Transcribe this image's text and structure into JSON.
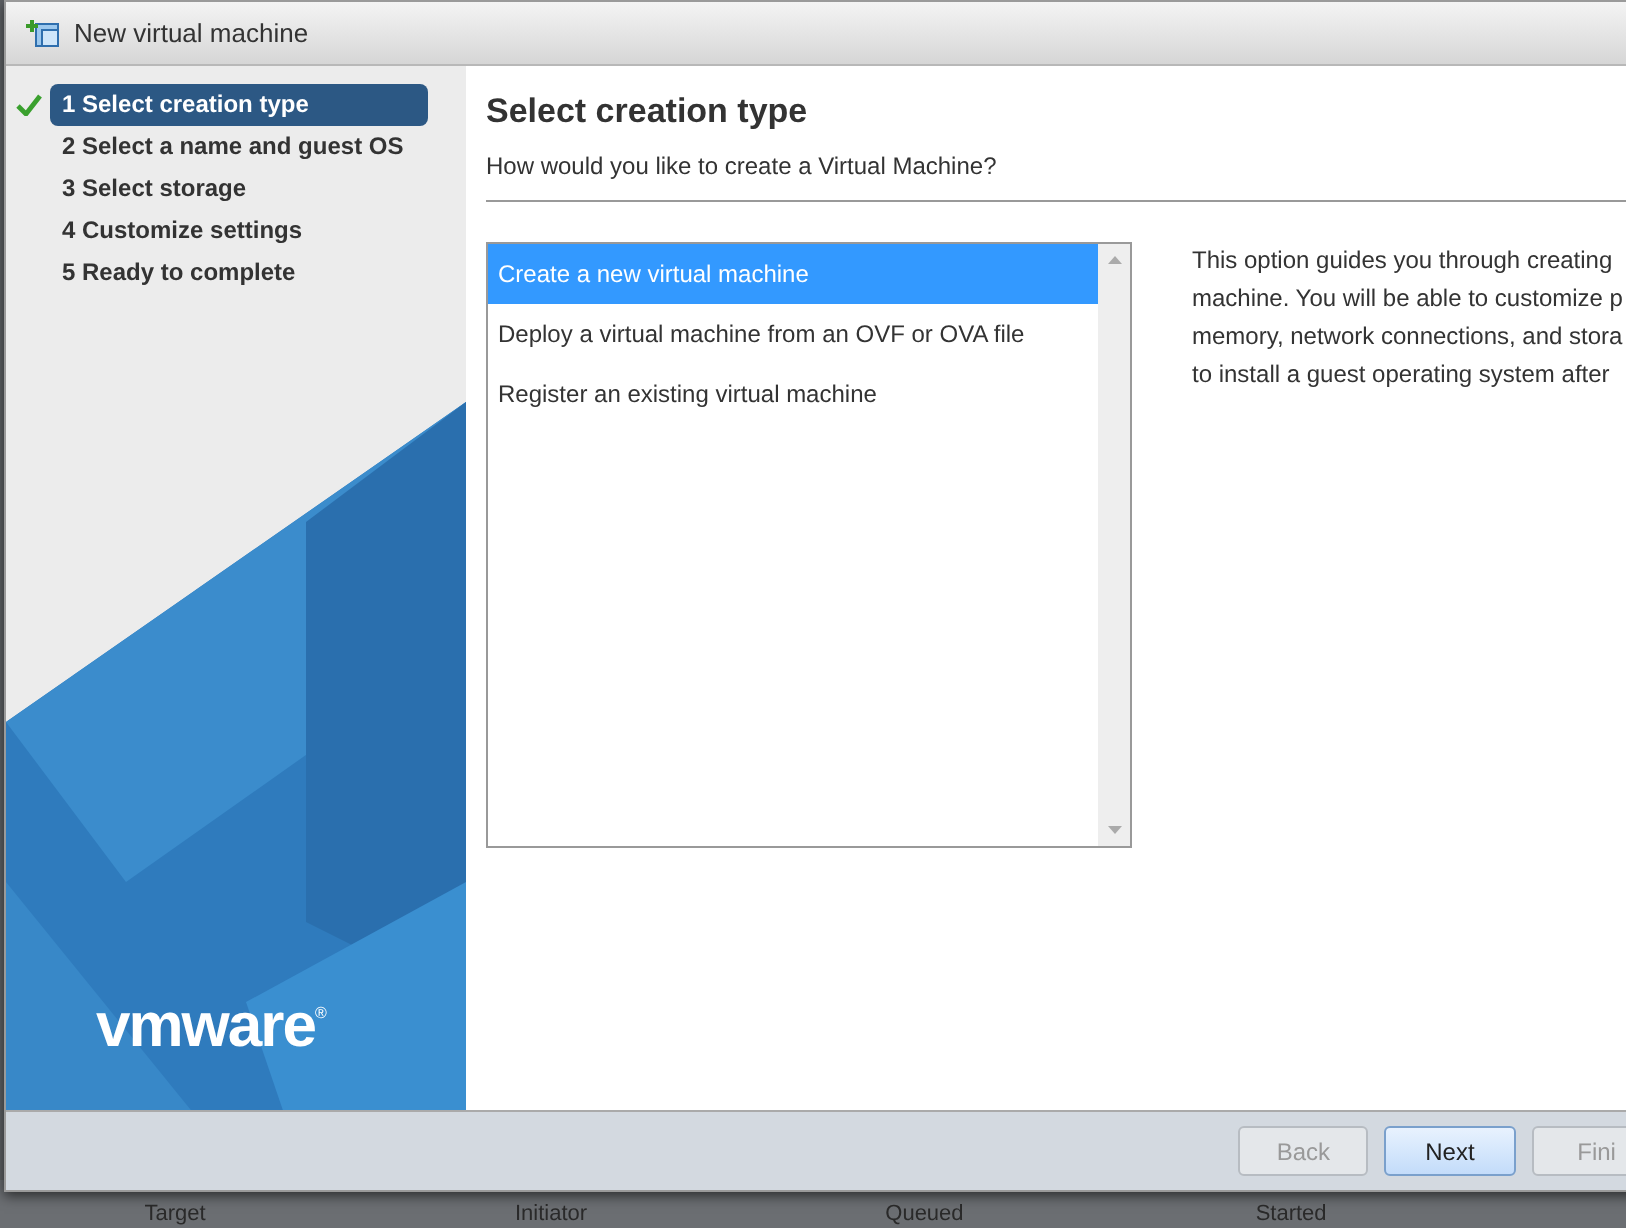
{
  "window": {
    "title": "New virtual machine"
  },
  "steps": [
    {
      "label": "1 Select creation type",
      "selected": true,
      "done": true
    },
    {
      "label": "2 Select a name and guest OS",
      "selected": false,
      "done": false
    },
    {
      "label": "3 Select storage",
      "selected": false,
      "done": false
    },
    {
      "label": "4 Customize settings",
      "selected": false,
      "done": false
    },
    {
      "label": "5 Ready to complete",
      "selected": false,
      "done": false
    }
  ],
  "logo": {
    "text": "vmware",
    "mark": "®"
  },
  "page": {
    "title": "Select creation type",
    "subtitle": "How would you like to create a Virtual Machine?"
  },
  "options": [
    {
      "label": "Create a new virtual machine",
      "selected": true
    },
    {
      "label": "Deploy a virtual machine from an OVF or OVA file",
      "selected": false
    },
    {
      "label": "Register an existing virtual machine",
      "selected": false
    }
  ],
  "description": [
    "This option guides you through creating",
    "machine. You will be able to customize p",
    "memory, network connections, and stora",
    "to install a guest operating system after"
  ],
  "buttons": [
    {
      "label": "Back",
      "disabled": true,
      "hover": false
    },
    {
      "label": "Next",
      "disabled": false,
      "hover": true
    },
    {
      "label": "Fini",
      "disabled": true,
      "hover": false
    }
  ],
  "background_table": {
    "columns": [
      "Target",
      "Initiator",
      "Queued",
      "Started"
    ]
  }
}
